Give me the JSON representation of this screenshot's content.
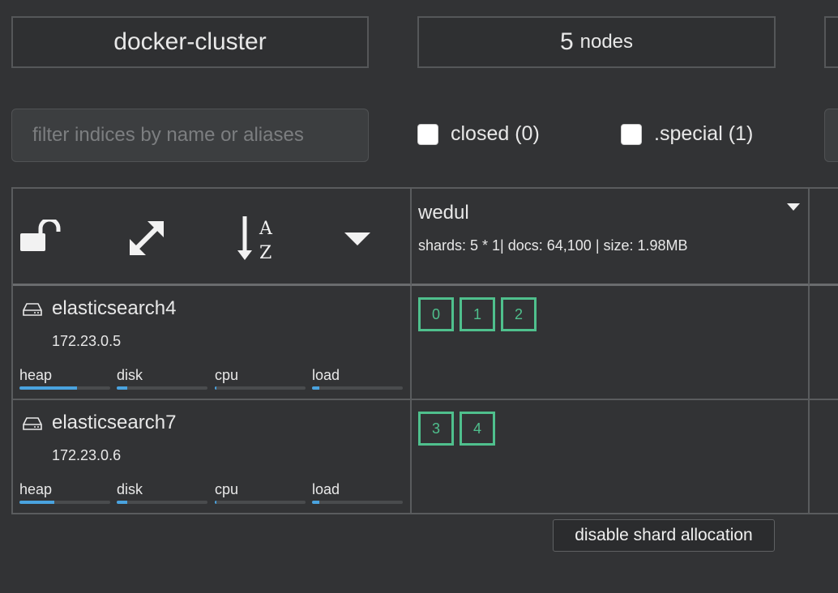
{
  "cluster": {
    "name": "docker-cluster",
    "nodes_count": "5",
    "nodes_label": "nodes"
  },
  "filter": {
    "placeholder": "filter indices by name or aliases",
    "value": "",
    "closed_label": "closed (0)",
    "special_label": ".special (1)"
  },
  "controls": {
    "icons": [
      "unlock-icon",
      "expand-icon",
      "sort-alpha-icon",
      "caret-down-icon"
    ]
  },
  "index": {
    "name": "wedul",
    "stats": "shards: 5 * 1| docs: 64,100 | size: 1.98MB"
  },
  "nodes": [
    {
      "name": "elasticsearch4",
      "ip": "172.23.0.5",
      "metrics": [
        {
          "label": "heap",
          "value": 0.63
        },
        {
          "label": "disk",
          "value": 0.12
        },
        {
          "label": "cpu",
          "value": 0.02
        },
        {
          "label": "load",
          "value": 0.08
        }
      ],
      "shards": [
        "0",
        "1",
        "2"
      ]
    },
    {
      "name": "elasticsearch7",
      "ip": "172.23.0.6",
      "metrics": [
        {
          "label": "heap",
          "value": 0.38
        },
        {
          "label": "disk",
          "value": 0.12
        },
        {
          "label": "cpu",
          "value": 0.02
        },
        {
          "label": "load",
          "value": 0.08
        }
      ],
      "shards": [
        "3",
        "4"
      ]
    }
  ],
  "tooltip": {
    "text": "disable shard allocation"
  },
  "colors": {
    "shard": "#4fc08d",
    "metric_fill": "#4aa3df",
    "background": "#323335"
  }
}
